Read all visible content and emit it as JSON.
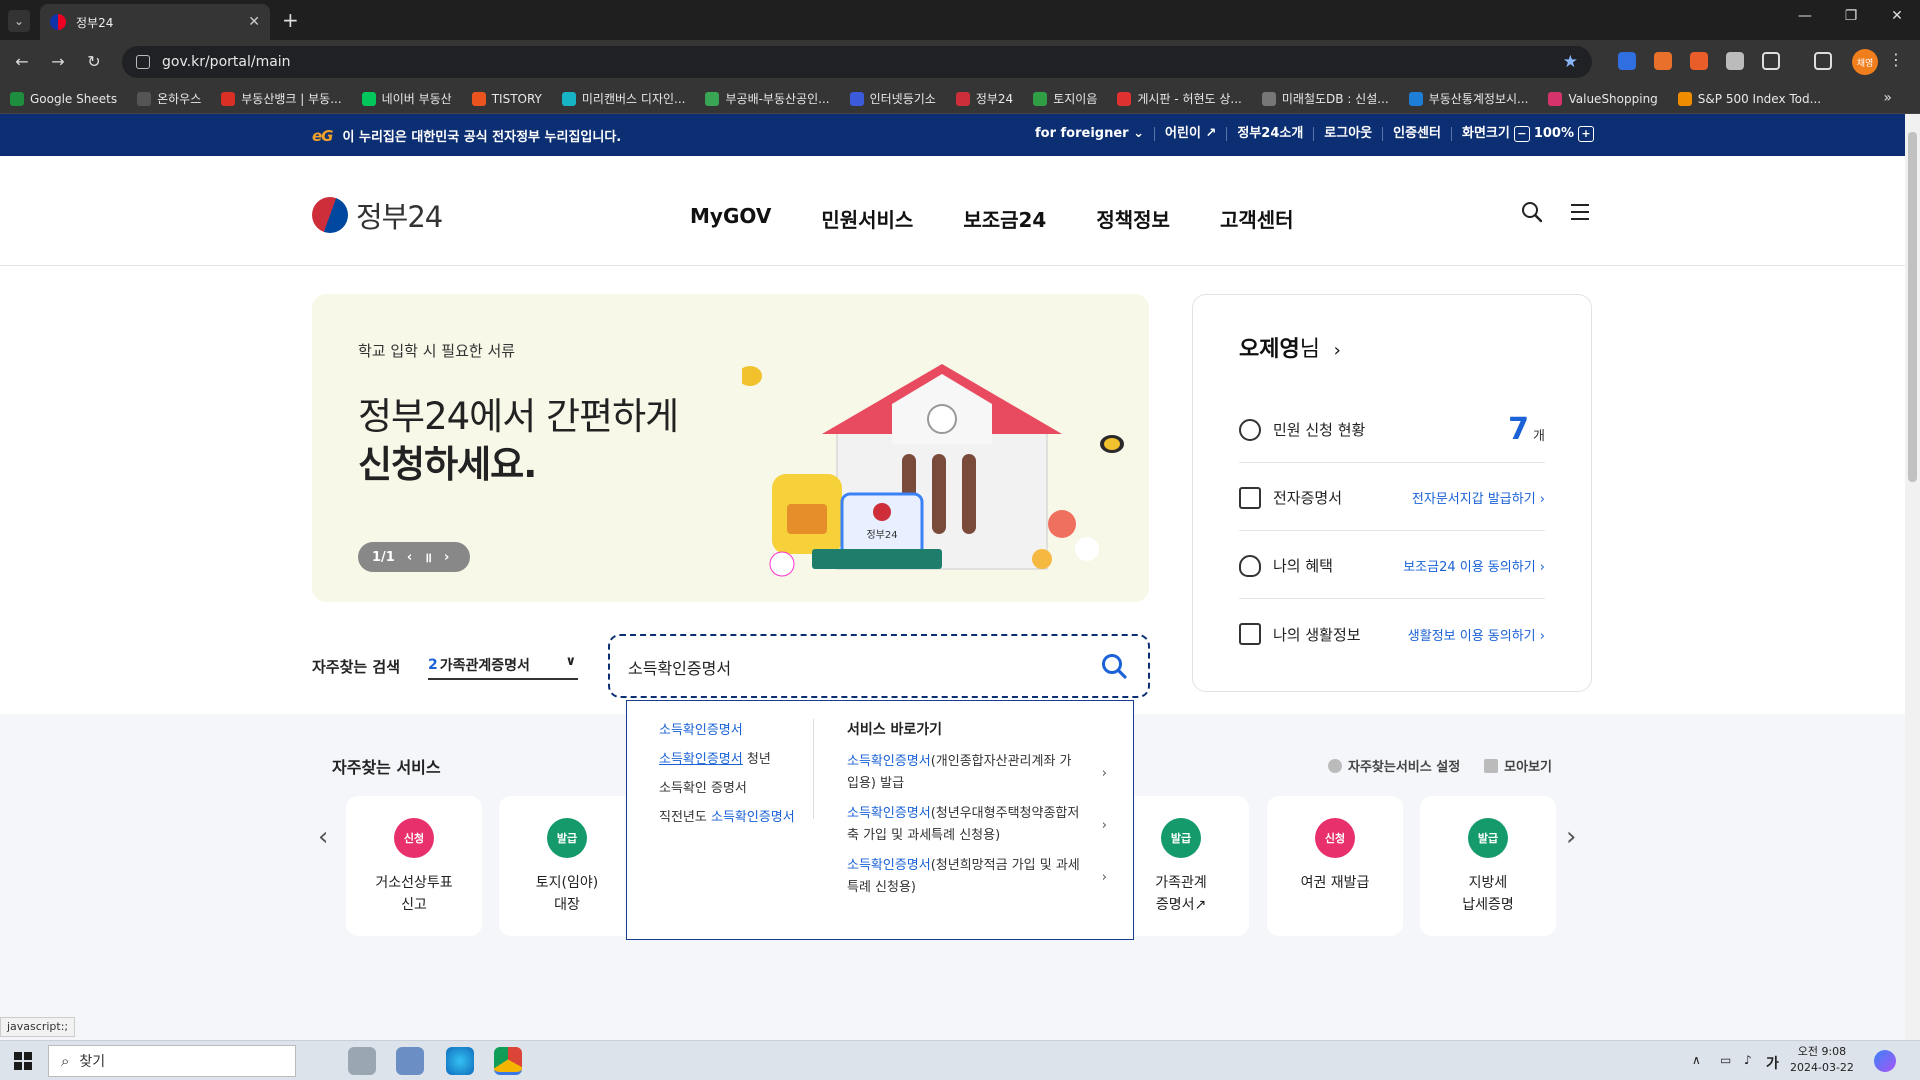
{
  "browser": {
    "tab_title": "정부24",
    "tab_close": "✕",
    "new_tab": "+",
    "url": "gov.kr/portal/main",
    "bookmarks": [
      {
        "label": "Google Sheets",
        "color": "#1e8e3e"
      },
      {
        "label": "온하우스",
        "color": "#555555"
      },
      {
        "label": "부동산뱅크 | 부동...",
        "color": "#d93025"
      },
      {
        "label": "네이버 부동산",
        "color": "#03c75a"
      },
      {
        "label": "TISTORY",
        "color": "#eb531f"
      },
      {
        "label": "미리캔버스 디자인...",
        "color": "#16b4c4"
      },
      {
        "label": "부공배-부동산공인...",
        "color": "#3aa655"
      },
      {
        "label": "인터넷등기소",
        "color": "#3b5bdb"
      },
      {
        "label": "정부24",
        "color": "#cd2e3a"
      },
      {
        "label": "토지이음",
        "color": "#2f9e44"
      },
      {
        "label": "게시판 - 허현도 상...",
        "color": "#e03131"
      },
      {
        "label": "미래철도DB : 신설...",
        "color": "#777777"
      },
      {
        "label": "부동산통계정보시...",
        "color": "#1c7ed6"
      },
      {
        "label": "ValueShopping",
        "color": "#d6336c"
      },
      {
        "label": "S&P 500 Index Tod...",
        "color": "#f08c00"
      }
    ],
    "bookmarks_more": "»",
    "profile_label": "채영"
  },
  "govbar": {
    "emblem_text": "eG",
    "notice": "이 누리집은 대한민국 공식 전자정부 누리집입니다.",
    "foreigner": "for foreigner",
    "kids": "어린이",
    "about": "정부24소개",
    "logout": "로그아웃",
    "cert": "인증센터",
    "screen_size": "화면크기",
    "zoom_minus": "−",
    "zoom_value": "100%",
    "zoom_plus": "+"
  },
  "header": {
    "logo": "정부24",
    "nav": [
      "MyGOV",
      "민원서비스",
      "보조금24",
      "정책정보",
      "고객센터"
    ]
  },
  "hero": {
    "subtitle": "학교 입학 시 필요한 서류",
    "title_line1": "정부24에서 간편하게",
    "title_line2": "신청하세요.",
    "pager": "1/1",
    "illus_label": "정부24"
  },
  "user_panel": {
    "name": "오제영",
    "suffix": "님",
    "rows": [
      {
        "label": "민원 신청 현황",
        "count": "7",
        "unit": "개"
      },
      {
        "label": "전자증명서",
        "link": "전자문서지갑 발급하기"
      },
      {
        "label": "나의 혜택",
        "link": "보조금24 이용 동의하기"
      },
      {
        "label": "나의 생활정보",
        "link": "생활정보 이용 동의하기"
      }
    ]
  },
  "search": {
    "freq_label": "자주찾는 검색",
    "rank": "2",
    "rank_term": "가족관계증명서",
    "value": "소득확인증명서",
    "autocomplete": {
      "suggestions": [
        {
          "pre": "",
          "hl": "소득확인증명서",
          "post": ""
        },
        {
          "pre": "",
          "hl": "소득확인증명서",
          "post": " 청년"
        },
        {
          "pre": "소득확인 증명서",
          "hl": "",
          "post": ""
        },
        {
          "pre": "직전년도 ",
          "hl": "소득확인증명서",
          "post": ""
        }
      ],
      "shortcut_title": "서비스 바로가기",
      "services": [
        {
          "hl": "소득확인증명서",
          "rest": "(개인종합자산관리계좌 가입용) 발급"
        },
        {
          "hl": "소득확인증명서",
          "rest": "(청년우대형주택청약종합저축 가입 및 과세특례 신청용)"
        },
        {
          "hl": "소득확인증명서",
          "rest": "(청년희망적금 가입 및 과세특례 신청용)"
        }
      ]
    }
  },
  "services": {
    "title": "자주찾는 서비스",
    "settings": "자주찾는서비스 설정",
    "view_all": "모아보기",
    "cards": [
      {
        "badge": "신청",
        "color": "red",
        "label": "거소선상투표\n신고"
      },
      {
        "badge": "발급",
        "color": "green",
        "label": "토지(임야)\n대장"
      },
      {
        "badge": "발급",
        "color": "green",
        "label": "가족관계\n증명서↗"
      },
      {
        "badge": "신청",
        "color": "red",
        "label": "여권 재발급"
      },
      {
        "badge": "발급",
        "color": "green",
        "label": "지방세\n납세증명"
      }
    ]
  },
  "status_bar": "javascript:;",
  "taskbar": {
    "search_placeholder": "찾기",
    "ime": "가",
    "time": "오전 9:08",
    "date": "2024-03-22"
  }
}
